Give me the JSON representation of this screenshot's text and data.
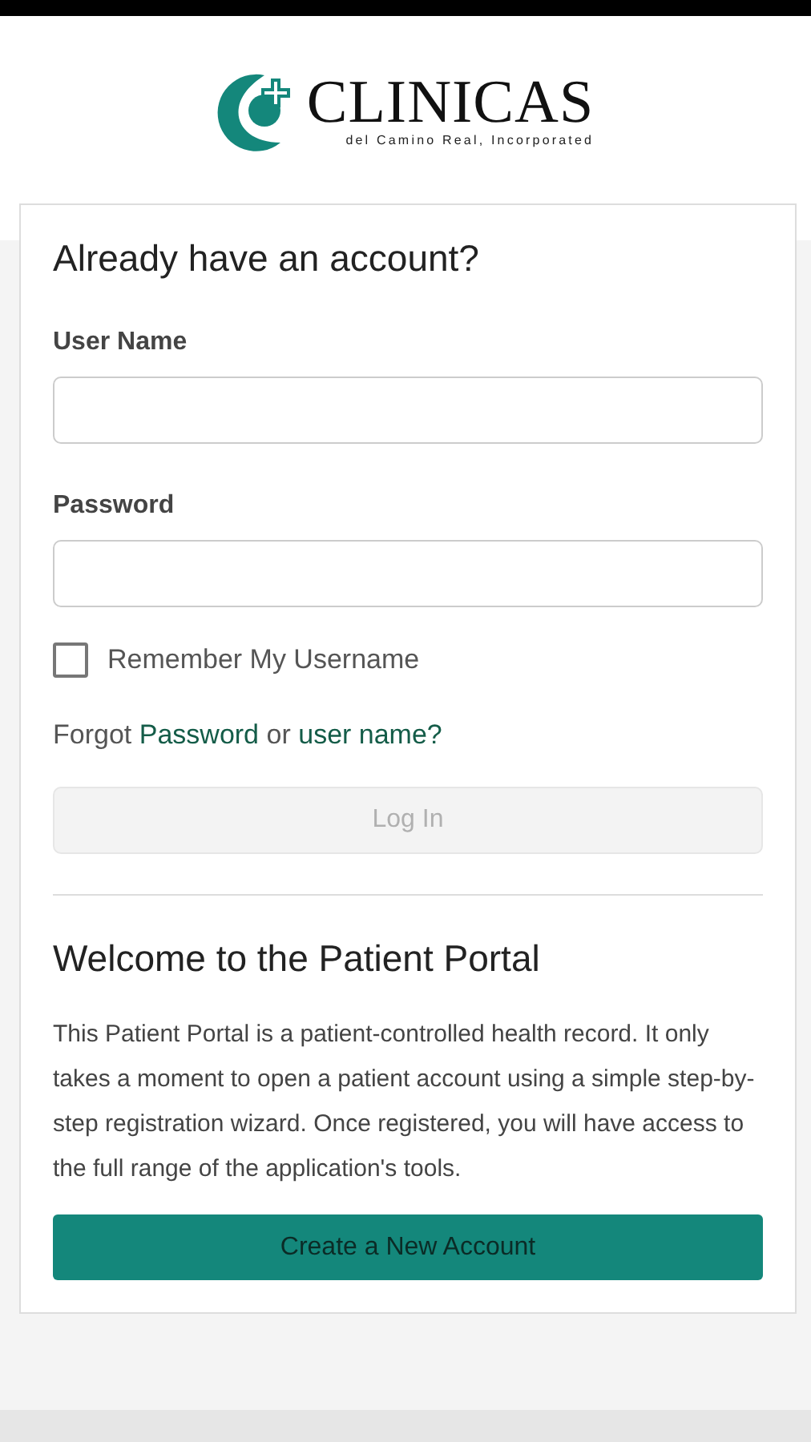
{
  "logo": {
    "name": "CLINICAS",
    "tagline": "del Camino Real, Incorporated"
  },
  "login": {
    "title": "Already have an account?",
    "fields": [
      {
        "label": "User Name"
      },
      {
        "label": "Password"
      }
    ],
    "remember": {
      "label": "Remember My Username",
      "checked": false
    },
    "forgot": {
      "prefix": "Forgot",
      "link1": "Password",
      "middle": "or",
      "link2": "user name?"
    },
    "submit": {
      "label": "Log In",
      "disabled": true
    }
  },
  "welcome": {
    "title": "Welcome to the Patient Portal",
    "text": "This Patient Portal is a patient-controlled health record. It only takes a moment to open a patient account using a simple step-by-step registration wizard. Once registered, you will have access to the full range of the application's tools.",
    "button": "Create a New Account"
  }
}
